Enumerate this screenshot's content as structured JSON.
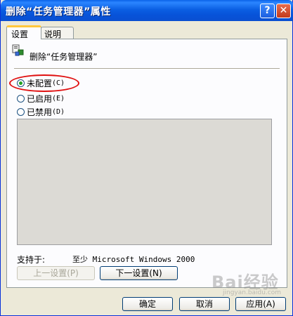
{
  "window": {
    "title": "删除“任务管理器”属性",
    "help_label": "?",
    "close_label": "✕"
  },
  "tabs": [
    {
      "label": "设置",
      "active": true
    },
    {
      "label": "说明",
      "active": false
    }
  ],
  "policy": {
    "icon": "group-policy-icon",
    "name": "删除“任务管理器”"
  },
  "options": [
    {
      "label": "未配置",
      "key": "(C)",
      "selected": true
    },
    {
      "label": "已启用",
      "key": "(E)",
      "selected": false
    },
    {
      "label": "已禁用",
      "key": "(D)",
      "selected": false
    }
  ],
  "support": {
    "label": "支持于:",
    "value": "至少 Microsoft Windows 2000"
  },
  "nav_buttons": {
    "prev": "上一设置(P)",
    "next": "下一设置(N)"
  },
  "footer_buttons": {
    "ok": "确定",
    "cancel": "取消",
    "apply": "应用(A)"
  },
  "watermark": {
    "text": "Bai经验",
    "url": "jingyan.baidu.com"
  },
  "colors": {
    "titlebar": "#0753d9",
    "highlight": "#e01010",
    "radio_dot": "#21a121"
  }
}
